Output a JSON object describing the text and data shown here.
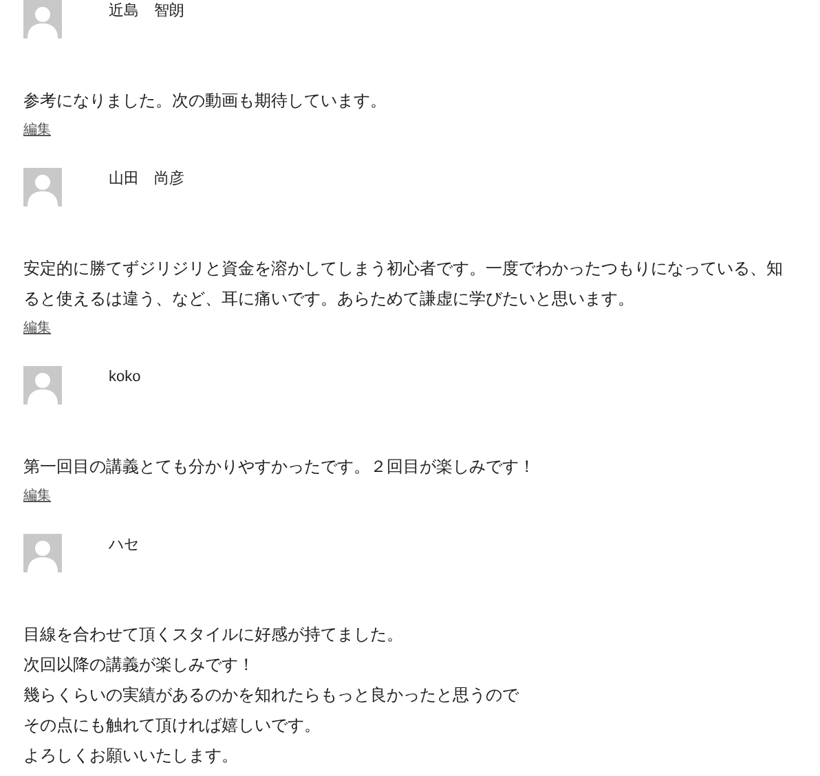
{
  "comments": [
    {
      "author": "近島　智朗",
      "lines": [
        "参考になりました。次の動画も期待しています。"
      ],
      "edit_link": "編集"
    },
    {
      "author": "山田　尚彦",
      "lines": [
        "安定的に勝てずジリジリと資金を溶かしてしまう初心者です。一度でわかったつもりになっている、知ると使えるは違う、など、耳に痛いです。あらためて謙虚に学びたいと思います。"
      ],
      "edit_link": "編集"
    },
    {
      "author": "koko",
      "lines": [
        "第一回目の講義とても分かりやすかったです。２回目が楽しみです！"
      ],
      "edit_link": "編集"
    },
    {
      "author": "ハセ",
      "lines": [
        "目線を合わせて頂くスタイルに好感が持てました。",
        "次回以降の講義が楽しみです！",
        "幾らくらいの実績があるのかを知れたらもっと良かったと思うので",
        "その点にも触れて頂ければ嬉しいです。",
        "よろしくお願いいたします。"
      ]
    }
  ]
}
